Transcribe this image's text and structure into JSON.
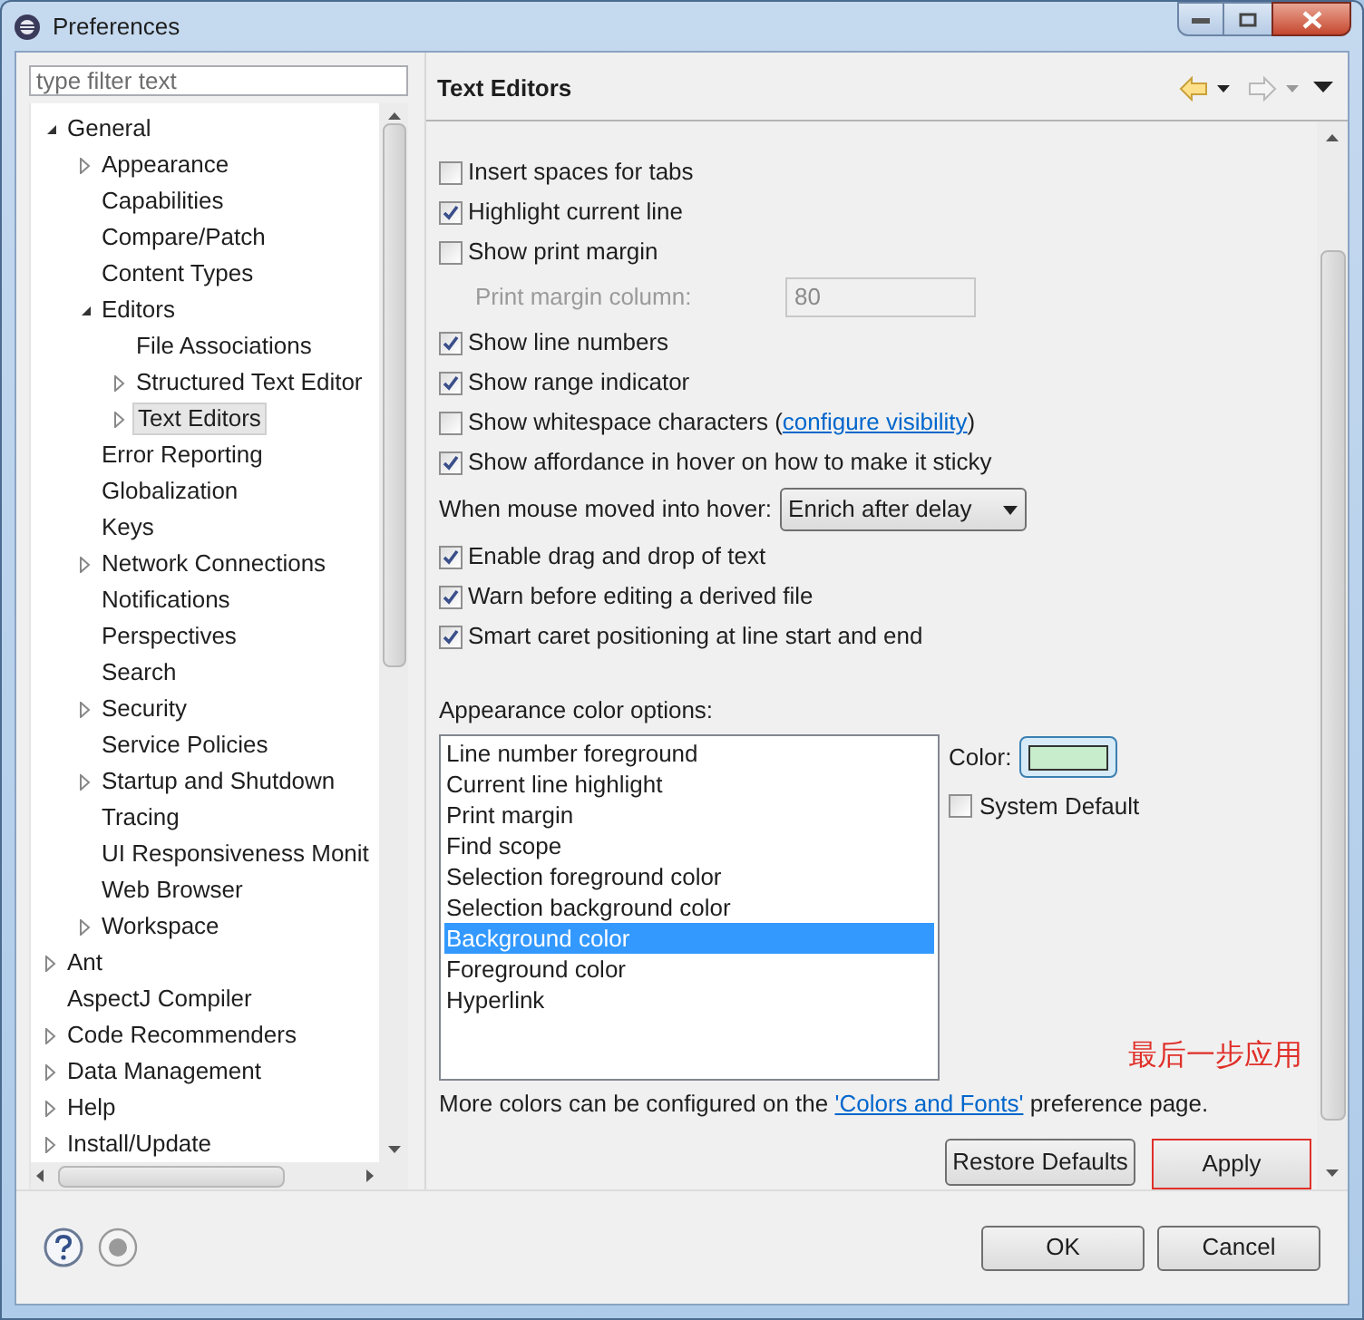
{
  "window": {
    "title": "Preferences"
  },
  "filter": {
    "placeholder": "type filter text"
  },
  "tree": [
    {
      "label": "General",
      "kind": "branch",
      "expanded": true,
      "selected": false,
      "children": [
        {
          "label": "Appearance",
          "kind": "branch",
          "expanded": false,
          "selected": false
        },
        {
          "label": "Capabilities",
          "kind": "leaf",
          "selected": false
        },
        {
          "label": "Compare/Patch",
          "kind": "leaf",
          "selected": false
        },
        {
          "label": "Content Types",
          "kind": "leaf",
          "selected": false
        },
        {
          "label": "Editors",
          "kind": "branch",
          "expanded": true,
          "selected": false,
          "children": [
            {
              "label": "File Associations",
              "kind": "leaf",
              "selected": false
            },
            {
              "label": "Structured Text Editor",
              "kind": "branch",
              "expanded": false,
              "selected": false
            },
            {
              "label": "Text Editors",
              "kind": "branch",
              "expanded": false,
              "selected": true
            }
          ]
        },
        {
          "label": "Error Reporting",
          "kind": "leaf",
          "selected": false
        },
        {
          "label": "Globalization",
          "kind": "leaf",
          "selected": false
        },
        {
          "label": "Keys",
          "kind": "leaf",
          "selected": false
        },
        {
          "label": "Network Connections",
          "kind": "branch",
          "expanded": false,
          "selected": false
        },
        {
          "label": "Notifications",
          "kind": "leaf",
          "selected": false
        },
        {
          "label": "Perspectives",
          "kind": "leaf",
          "selected": false
        },
        {
          "label": "Search",
          "kind": "leaf",
          "selected": false
        },
        {
          "label": "Security",
          "kind": "branch",
          "expanded": false,
          "selected": false
        },
        {
          "label": "Service Policies",
          "kind": "leaf",
          "selected": false
        },
        {
          "label": "Startup and Shutdown",
          "kind": "branch",
          "expanded": false,
          "selected": false
        },
        {
          "label": "Tracing",
          "kind": "leaf",
          "selected": false
        },
        {
          "label": "UI Responsiveness Monit",
          "kind": "leaf",
          "selected": false
        },
        {
          "label": "Web Browser",
          "kind": "leaf",
          "selected": false
        },
        {
          "label": "Workspace",
          "kind": "branch",
          "expanded": false,
          "selected": false
        }
      ]
    },
    {
      "label": "Ant",
      "kind": "branch",
      "expanded": false,
      "selected": false
    },
    {
      "label": "AspectJ Compiler",
      "kind": "leaf",
      "selected": false
    },
    {
      "label": "Code Recommenders",
      "kind": "branch",
      "expanded": false,
      "selected": false
    },
    {
      "label": "Data Management",
      "kind": "branch",
      "expanded": false,
      "selected": false
    },
    {
      "label": "Help",
      "kind": "branch",
      "expanded": false,
      "selected": false
    },
    {
      "label": "Install/Update",
      "kind": "branch",
      "expanded": false,
      "selected": false
    }
  ],
  "page": {
    "title": "Text Editors",
    "settings": [
      {
        "kind": "checkbox",
        "label": "Insert spaces for tabs",
        "checked": false
      },
      {
        "kind": "checkbox",
        "label": "Highlight current line",
        "checked": true
      },
      {
        "kind": "checkbox",
        "label": "Show print margin",
        "checked": false
      },
      {
        "kind": "field",
        "label": "Print margin column:",
        "value": "80",
        "disabled": true
      },
      {
        "kind": "checkbox",
        "label": "Show line numbers",
        "checked": true
      },
      {
        "kind": "checkbox",
        "label": "Show range indicator",
        "checked": true
      },
      {
        "kind": "checkbox",
        "label": "Show whitespace characters (",
        "link": "configure visibility",
        "label_end": ")",
        "checked": false
      },
      {
        "kind": "checkbox",
        "label": "Show affordance in hover on how to make it sticky",
        "checked": true
      },
      {
        "kind": "combo",
        "label": "When mouse moved into hover:",
        "value": "Enrich after delay"
      },
      {
        "kind": "checkbox",
        "label": "Enable drag and drop of text",
        "checked": true
      },
      {
        "kind": "checkbox",
        "label": "Warn before editing a derived file",
        "checked": true
      },
      {
        "kind": "checkbox",
        "label": "Smart caret positioning at line start and end",
        "checked": true
      }
    ],
    "appearance_label": "Appearance color options:",
    "color_options": [
      {
        "label": "Line number foreground",
        "selected": false
      },
      {
        "label": "Current line highlight",
        "selected": false
      },
      {
        "label": "Print margin",
        "selected": false
      },
      {
        "label": "Find scope",
        "selected": false
      },
      {
        "label": "Selection foreground color",
        "selected": false
      },
      {
        "label": "Selection background color",
        "selected": false
      },
      {
        "label": "Background color",
        "selected": true
      },
      {
        "label": "Foreground color",
        "selected": false
      },
      {
        "label": "Hyperlink",
        "selected": false
      }
    ],
    "color_label": "Color:",
    "color": "#c7edcc",
    "system_default": {
      "label": "System Default",
      "checked": false
    },
    "annotation": "最后一步应用",
    "more_colors": {
      "before": "More colors can be configured on the ",
      "link": "'Colors and Fonts'",
      "after": " preference page."
    },
    "buttons": [
      "Restore Defaults",
      "Apply"
    ]
  },
  "dialog_buttons": [
    "OK",
    "Cancel"
  ]
}
